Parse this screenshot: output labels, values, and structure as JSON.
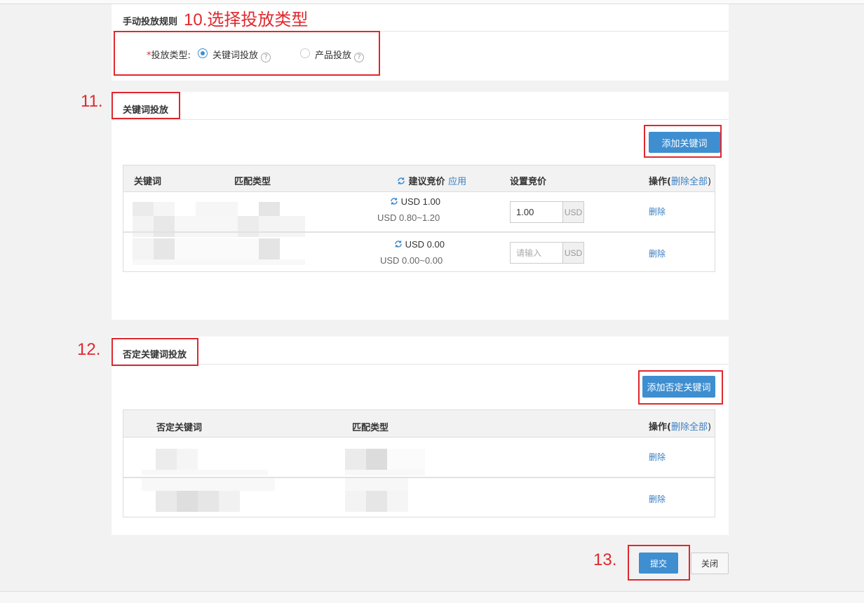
{
  "manual_rules": {
    "title": "手动投放规则",
    "step_label": "10.选择投放类型",
    "type_label": "投放类型:",
    "required_mark": "*",
    "options": [
      {
        "label": "关键词投放",
        "selected": true
      },
      {
        "label": "产品投放",
        "selected": false
      }
    ],
    "help_glyph": "?"
  },
  "keyword_section": {
    "step_label": "11.",
    "title": "关键词投放",
    "add_button": "添加关键词",
    "columns": {
      "keyword": "关键词",
      "match_type": "匹配类型",
      "suggested_bid": "建议竞价",
      "apply": "应用",
      "set_bid": "设置竞价",
      "action": "操作(",
      "delete_all": "删除全部",
      "close_paren": ")"
    },
    "rows": [
      {
        "bid": "USD 1.00",
        "range": "USD 0.80~1.20",
        "input_value": "1.00",
        "input_placeholder": "",
        "unit": "USD",
        "delete": "删除"
      },
      {
        "bid": "USD 0.00",
        "range": "USD 0.00~0.00",
        "input_value": "",
        "input_placeholder": "请输入",
        "unit": "USD",
        "delete": "删除"
      }
    ]
  },
  "negative_section": {
    "step_label": "12.",
    "title": "否定关键词投放",
    "add_button": "添加否定关键词",
    "columns": {
      "keyword": "否定关键词",
      "match_type": "匹配类型",
      "action": "操作(",
      "delete_all": "删除全部",
      "close_paren": ")"
    },
    "rows": [
      {
        "delete": "删除"
      },
      {
        "delete": "删除"
      }
    ]
  },
  "footer": {
    "step_label": "13.",
    "submit": "提交",
    "close": "关闭"
  },
  "colors": {
    "accent": "#3e8ed0",
    "annotation": "#e0282e",
    "link": "#3a7fc2"
  }
}
